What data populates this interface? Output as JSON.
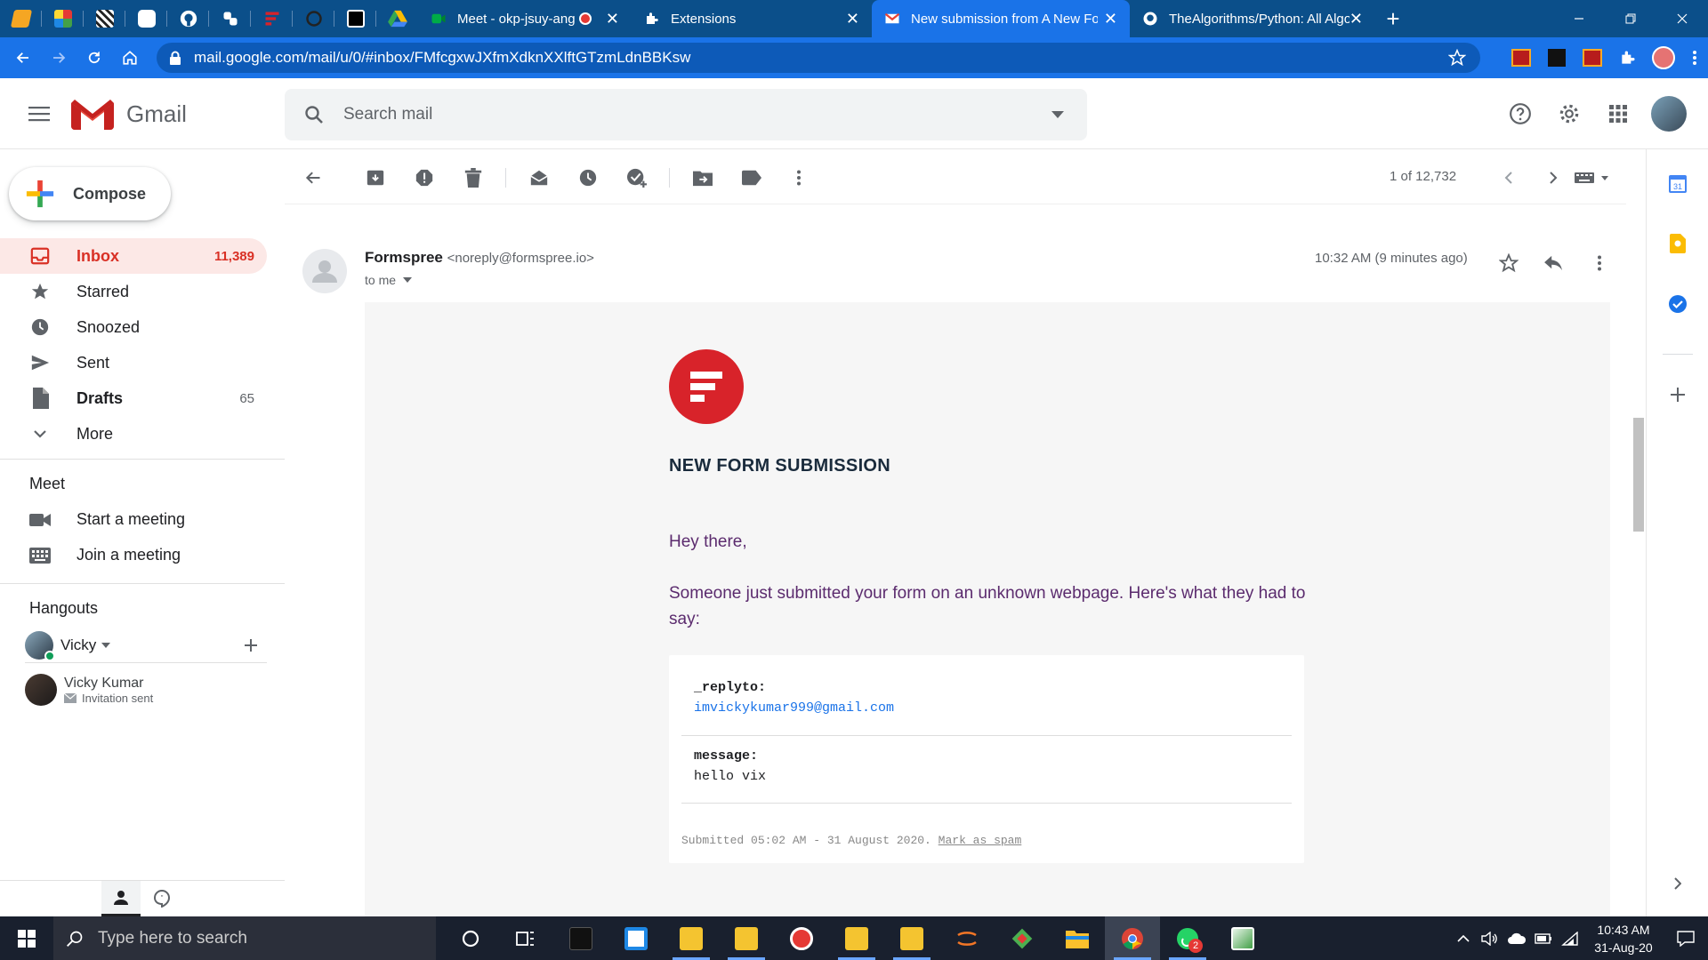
{
  "browser": {
    "tabs": [
      {
        "title": "Meet - okp-jsuy-ang",
        "favicon": "google-meet-icon",
        "recording": true
      },
      {
        "title": "Extensions",
        "favicon": "puzzle-icon"
      },
      {
        "title": "New submission from A New Fo",
        "favicon": "gmail-icon",
        "active": true
      },
      {
        "title": "TheAlgorithms/Python: All Algo",
        "favicon": "github-icon"
      }
    ],
    "url": "mail.google.com/mail/u/0/#inbox/FMfcgxwJXfmXdknXXlftGTzmLdnBBKsw"
  },
  "gmail": {
    "product_name": "Gmail",
    "search_placeholder": "Search mail",
    "compose_label": "Compose",
    "nav": [
      {
        "label": "Inbox",
        "count": "11,389",
        "icon": "inbox-icon"
      },
      {
        "label": "Starred",
        "count": "",
        "icon": "star-icon"
      },
      {
        "label": "Snoozed",
        "count": "",
        "icon": "clock-icon"
      },
      {
        "label": "Sent",
        "count": "",
        "icon": "send-icon"
      },
      {
        "label": "Drafts",
        "count": "65",
        "icon": "draft-icon"
      },
      {
        "label": "More",
        "count": "",
        "icon": "chevron-down-icon"
      }
    ],
    "meet": {
      "heading": "Meet",
      "start": "Start a meeting",
      "join": "Join a meeting"
    },
    "hangouts": {
      "heading": "Hangouts",
      "me": "Vicky",
      "contact_name": "Vicky Kumar",
      "contact_status": "Invitation sent"
    },
    "pager": "1 of 12,732"
  },
  "message": {
    "sender_name": "Formspree",
    "sender_email": "<noreply@formspree.io>",
    "to": "to me",
    "time": "10:32 AM (9 minutes ago)",
    "body": {
      "heading": "NEW FORM SUBMISSION",
      "greeting": "Hey there,",
      "intro": "Someone just submitted your form on an unknown webpage. Here's what they had to say:",
      "fields": [
        {
          "key": "_replyto:",
          "value": "imvickykumar999@gmail.com",
          "is_link": true
        },
        {
          "key": "message:",
          "value": "hello vix",
          "is_link": false
        }
      ],
      "submitted": "Submitted 05:02 AM - 31 August 2020.",
      "spam_link": "Mark as spam"
    }
  },
  "taskbar": {
    "search_placeholder": "Type here to search",
    "time": "10:43 AM",
    "date": "31-Aug-20",
    "whatsapp_badge": "2"
  },
  "colors": {
    "chrome_tabstrip": "#0b4f8a",
    "chrome_toolbar": "#1a73e8",
    "gmail_red": "#d93025",
    "formspree_red": "#d8232a",
    "body_purple": "#5b2b6e"
  }
}
